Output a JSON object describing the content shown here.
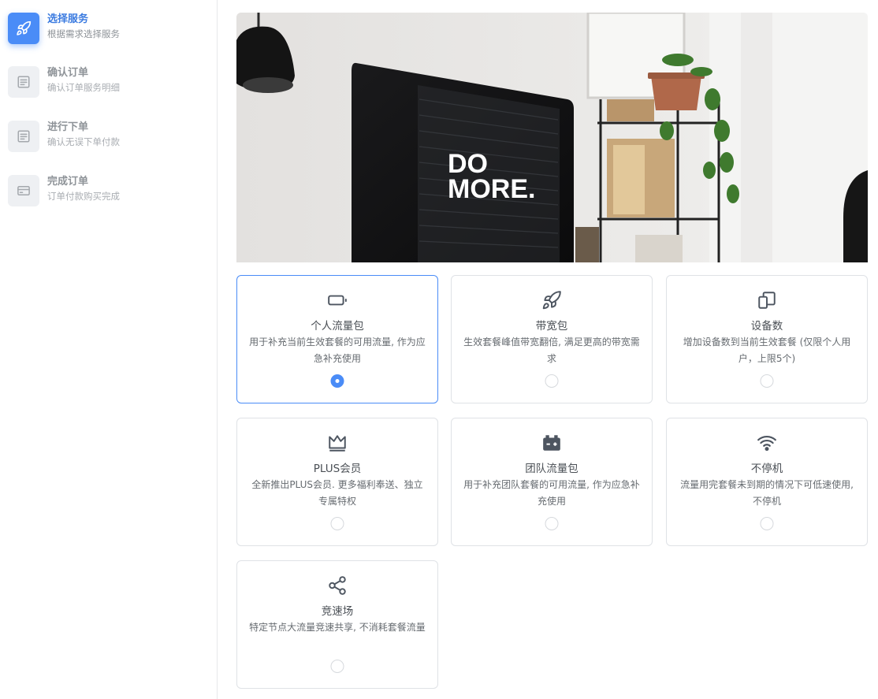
{
  "steps": [
    {
      "title": "选择服务",
      "subtitle": "根据需求选择服务",
      "icon": "rocket-icon",
      "active": true
    },
    {
      "title": "确认订单",
      "subtitle": "确认订单服务明细",
      "icon": "document-icon",
      "active": false
    },
    {
      "title": "进行下单",
      "subtitle": "确认无误下单付款",
      "icon": "document-icon",
      "active": false
    },
    {
      "title": "完成订单",
      "subtitle": "订单付款购买完成",
      "icon": "card-icon",
      "active": false
    }
  ],
  "hero": {
    "screen_text_line1": "DO",
    "screen_text_line2": "MORE."
  },
  "options": [
    {
      "icon": "battery-icon",
      "title": "个人流量包",
      "desc": "用于补充当前生效套餐的可用流量, 作为应急补充使用",
      "selected": true
    },
    {
      "icon": "rocket-icon",
      "title": "带宽包",
      "desc": "生效套餐峰值带宽翻倍, 满足更高的带宽需求",
      "selected": false
    },
    {
      "icon": "devices-icon",
      "title": "设备数",
      "desc": "增加设备数到当前生效套餐 (仅限个人用户，上限5个)",
      "selected": false
    },
    {
      "icon": "crown-icon",
      "title": "PLUS会员",
      "desc": "全新推出PLUS会员. 更多福利奉送、独立专属特权",
      "selected": false
    },
    {
      "icon": "team-battery-icon",
      "title": "团队流量包",
      "desc": "用于补充团队套餐的可用流量, 作为应急补充使用",
      "selected": false
    },
    {
      "icon": "wifi-icon",
      "title": "不停机",
      "desc": "流量用完套餐未到期的情况下可低速使用, 不停机",
      "selected": false
    },
    {
      "icon": "share-icon",
      "title": "竞速场",
      "desc": "特定节点大流量竞速共享, 不消耗套餐流量",
      "selected": false
    }
  ],
  "colors": {
    "accent": "#4a8cf7",
    "accent_text": "#3b7be0",
    "border": "#dfe2e6"
  }
}
